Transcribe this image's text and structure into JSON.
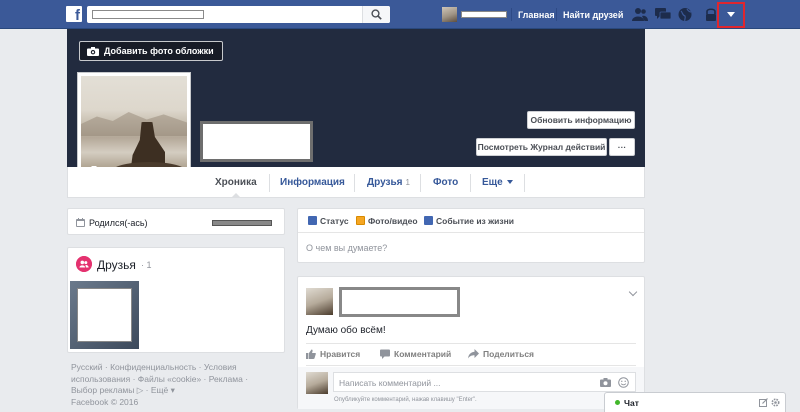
{
  "header": {
    "logo": "f",
    "nav": {
      "home": "Главная",
      "find_friends": "Найти друзей"
    }
  },
  "cover": {
    "add_cover_label": "Добавить фото обложки",
    "update_info_label": "Обновить информацию",
    "activity_log_label": "Посмотреть Журнал действий",
    "more_label": "···"
  },
  "tabs": {
    "timeline": "Хроника",
    "about": "Информация",
    "friends": "Друзья",
    "friends_count": "1",
    "photos": "Фото",
    "more": "Еще"
  },
  "intro": {
    "born": "Родился(-ась)"
  },
  "friends_box": {
    "title": "Друзья",
    "count": "· 1"
  },
  "footer": {
    "line1": "Русский · Конфиденциальность · Условия",
    "line2": "использования · Файлы «cookie» · Реклама ·",
    "line3": "Выбор рекламы ▷ · Ещё ▾",
    "line4": "Facebook © 2016"
  },
  "composer": {
    "status_label": "Статус",
    "photo_label": "Фото/видео",
    "event_label": "Событие из жизни",
    "placeholder": "О чем вы думаете?"
  },
  "post": {
    "text": "Думаю обо всём!",
    "like_label": "Нравится",
    "comment_label": "Комментарий",
    "share_label": "Поделиться",
    "comment_placeholder": "Написать комментарий ...",
    "comment_hint": "Опубликуйте комментарий, нажав клавишу \"Enter\"."
  },
  "chat": {
    "label": "Чат"
  },
  "colors": {
    "brand": "#3b5998",
    "highlight": "#e0262d",
    "online": "#42b72a"
  }
}
